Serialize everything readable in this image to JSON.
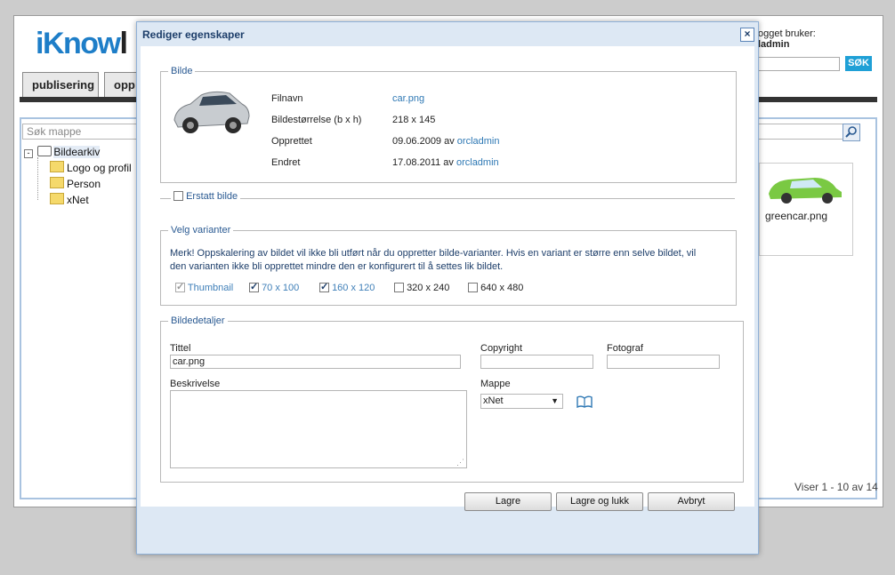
{
  "background_app": {
    "logo": {
      "left": "iKnow",
      "right": "l"
    },
    "tabs": [
      {
        "label": "publisering"
      },
      {
        "label": "opp"
      }
    ],
    "user_label": "ogget bruker:",
    "user_name": "ladmin",
    "search_button": "SØK",
    "folder_search_placeholder": "Søk mappe",
    "tree": {
      "root": "Bildearkiv",
      "children": [
        "Logo og profil",
        "Person",
        "xNet"
      ]
    },
    "thumbnail_caption": "greencar.png",
    "pager": "Viser 1 - 10 av 14"
  },
  "dialog": {
    "title": "Rediger egenskaper",
    "close_icon": "close-icon",
    "image_section": {
      "legend": "Bilde",
      "rows": [
        {
          "label": "Filnavn",
          "value": "car.png",
          "link": ""
        },
        {
          "label": "Bildestørrelse (b x h)",
          "value": "218 x 145",
          "link": ""
        },
        {
          "label": "Opprettet",
          "value": "09.06.2009 av ",
          "link": "orcladmin"
        },
        {
          "label": "Endret",
          "value": "17.08.2011 av ",
          "link": "orcladmin"
        }
      ]
    },
    "replace_label": "Erstatt bilde",
    "variants": {
      "legend": "Velg varianter",
      "note": "Merk! Oppskalering av bildet vil ikke bli utført når du oppretter bilde-varianter. Hvis en variant er større enn selve bildet, vil den varianten ikke bli opprettet mindre den er konfigurert til å settes lik bildet.",
      "options": [
        {
          "label": "Thumbnail",
          "checked": true,
          "disabled": true
        },
        {
          "label": "70 x 100",
          "checked": true,
          "disabled": false
        },
        {
          "label": "160 x 120",
          "checked": true,
          "disabled": false
        },
        {
          "label": "320 x 240",
          "checked": false,
          "disabled": false
        },
        {
          "label": "640 x 480",
          "checked": false,
          "disabled": false
        }
      ]
    },
    "details": {
      "legend": "Bildedetaljer",
      "title_label": "Tittel",
      "title_value": "car.png",
      "copyright_label": "Copyright",
      "copyright_value": "",
      "photographer_label": "Fotograf",
      "photographer_value": "",
      "description_label": "Beskrivelse",
      "description_value": "",
      "folder_label": "Mappe",
      "folder_value": "xNet"
    },
    "buttons": {
      "save": "Lagre",
      "save_close": "Lagre og lukk",
      "cancel": "Avbryt"
    }
  }
}
